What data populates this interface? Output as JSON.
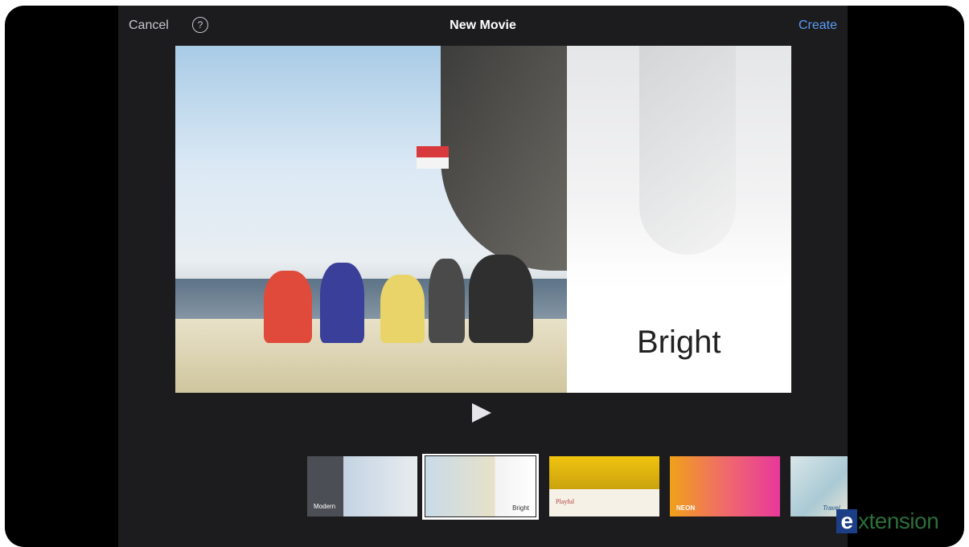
{
  "topbar": {
    "cancel_label": "Cancel",
    "help_glyph": "?",
    "title": "New Movie",
    "create_label": "Create"
  },
  "preview": {
    "theme_label": "Bright"
  },
  "themes": [
    {
      "label": "Modern"
    },
    {
      "label": "Bright",
      "selected": true
    },
    {
      "label": "Playful"
    },
    {
      "label": "NEON"
    },
    {
      "label": "Travel"
    }
  ],
  "watermark": {
    "brand_text": "xtension",
    "brand_letter": "e"
  },
  "colors": {
    "background": "#1c1c1e",
    "accent": "#5b9cf5",
    "brand_green": "#2c6e3a",
    "brand_blue": "#1c3e86"
  },
  "icons": [
    "help-circle-icon",
    "play-icon"
  ]
}
